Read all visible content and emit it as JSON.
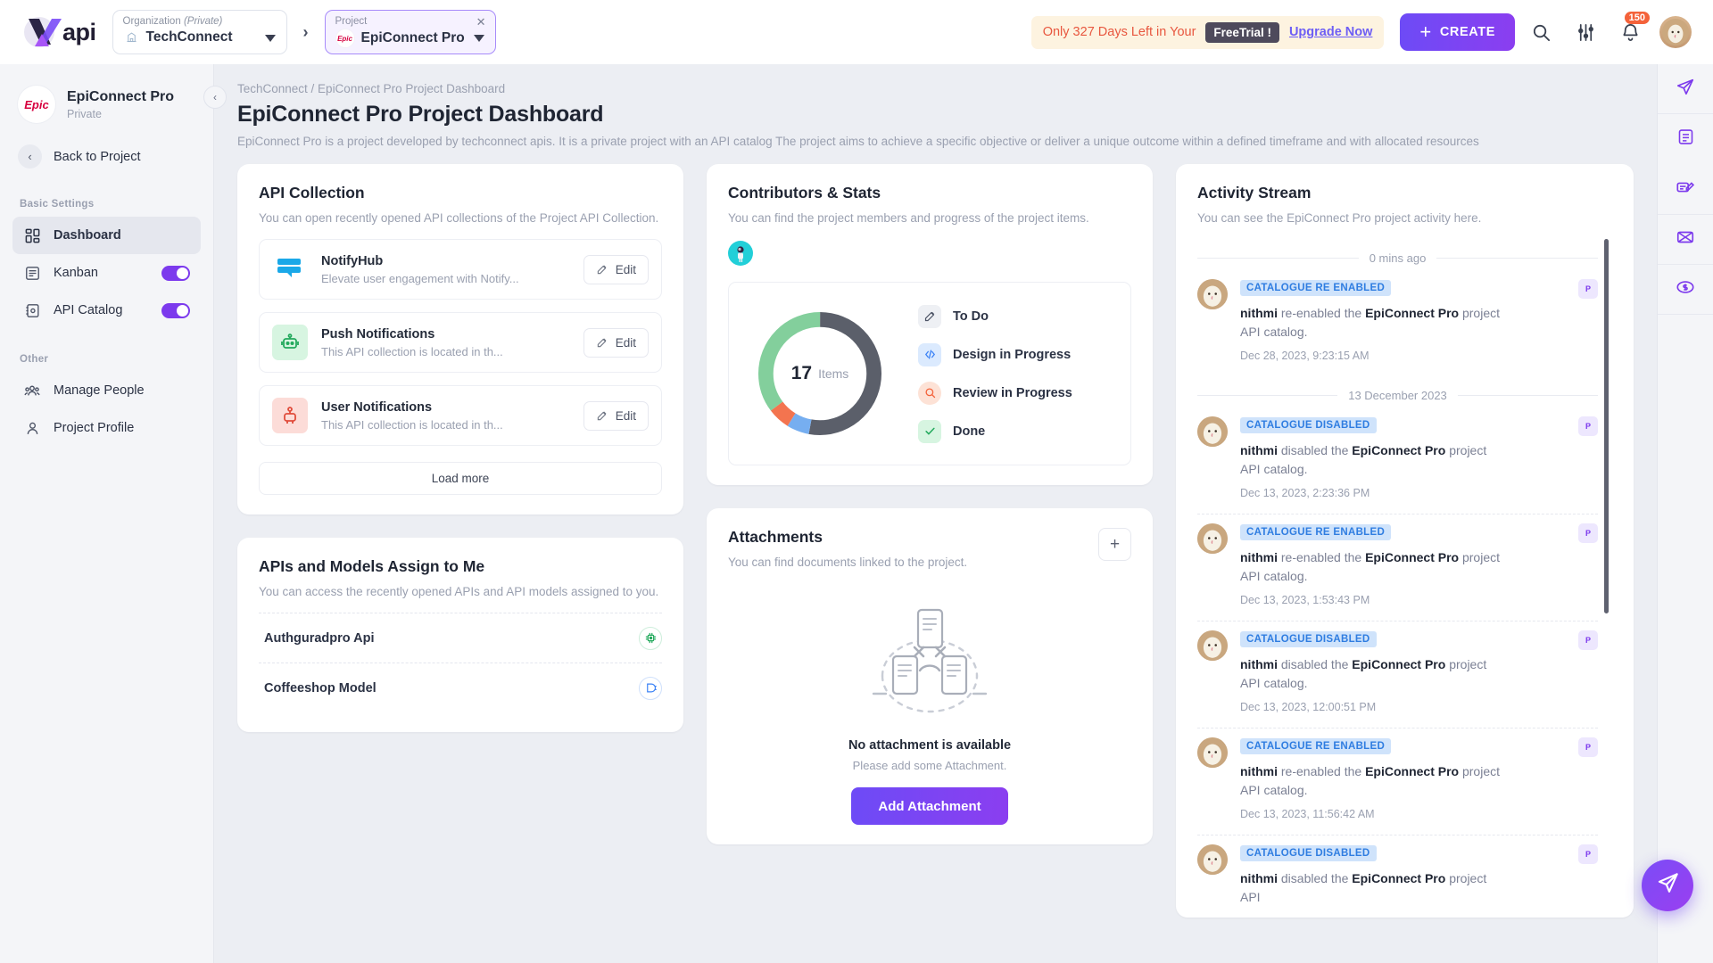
{
  "topbar": {
    "logo_text": "api",
    "organization": {
      "label": "Organization",
      "label_italic": "(Private)",
      "value": "TechConnect"
    },
    "project": {
      "label": "Project",
      "value": "EpiConnect Pro",
      "close_icon": "close-icon"
    },
    "trial": {
      "message": "Only 327 Days Left in Your",
      "pill": "FreeTrial !",
      "upgrade": "Upgrade Now"
    },
    "create_button": "CREATE",
    "notification_count": "150",
    "icons": [
      "search-icon",
      "filter-sliders-icon",
      "bell-icon",
      "user-avatar"
    ]
  },
  "sidebar": {
    "project_name": "EpiConnect Pro",
    "project_visibility": "Private",
    "project_badge": "Epic",
    "back_label": "Back to Project",
    "groups": [
      {
        "title": "Basic Settings",
        "items": [
          {
            "label": "Dashboard",
            "icon": "dashboard-grid-icon",
            "active": true,
            "toggle": false
          },
          {
            "label": "Kanban",
            "icon": "kanban-board-icon",
            "active": false,
            "toggle": true
          },
          {
            "label": "API Catalog",
            "icon": "api-catalog-icon",
            "active": false,
            "toggle": true
          }
        ]
      },
      {
        "title": "Other",
        "items": [
          {
            "label": "Manage People",
            "icon": "people-group-icon",
            "active": false,
            "toggle": false
          },
          {
            "label": "Project Profile",
            "icon": "person-icon",
            "active": false,
            "toggle": false
          }
        ]
      }
    ]
  },
  "page": {
    "breadcrumb": "TechConnect / EpiConnect Pro Project Dashboard",
    "title": "EpiConnect Pro Project Dashboard",
    "description": "EpiConnect Pro is a project developed by techconnect apis. It is a private project with an API catalog The project aims to achieve a specific objective or deliver a unique outcome within a defined timeframe and with allocated resources"
  },
  "api_collection": {
    "title": "API Collection",
    "subtitle": "You can open recently opened API collections of the Project API Collection.",
    "edit_label": "Edit",
    "load_more": "Load more",
    "items": [
      {
        "name": "NotifyHub",
        "desc": "Elevate user engagement with Notify...",
        "icon": "chat-stack-icon",
        "icon_bg": "#ffffff",
        "icon_color": "#1aa8e8"
      },
      {
        "name": "Push Notifications",
        "desc": "This API collection is located in th...",
        "icon": "robot-icon",
        "icon_bg": "#d7f5e1",
        "icon_color": "#22a95c"
      },
      {
        "name": "User Notifications",
        "desc": "This API collection is located in th...",
        "icon": "user-robot-icon",
        "icon_bg": "#fcdcd8",
        "icon_color": "#e04b3a"
      }
    ]
  },
  "assign": {
    "title": "APIs and Models Assign to Me",
    "subtitle": "You can access the recently opened APIs and API models assigned to you.",
    "items": [
      {
        "name": "Authguradpro Api",
        "icon": "chip-icon",
        "color": "#22a95c"
      },
      {
        "name": "Coffeeshop Model",
        "icon": "model-plug-icon",
        "color": "#3b82f6"
      }
    ]
  },
  "contributors": {
    "title": "Contributors & Stats",
    "subtitle": "You can find the project members and progress of the project items.",
    "avatar": "astronaut-avatar"
  },
  "chart_data": {
    "type": "pie",
    "title": "Project Items Progress",
    "center_value": "17",
    "center_label": "Items",
    "total": 17,
    "categories": [
      "To Do",
      "Design in Progress",
      "Review in Progress",
      "Done"
    ],
    "values": [
      9,
      1,
      1,
      6
    ],
    "colors": [
      "#5b5f6a",
      "#83cf9c",
      "#f3744f",
      "#76aef0"
    ],
    "legend": [
      {
        "label": "To Do",
        "icon": "edit-square-icon",
        "icon_bg": "#eef0f4",
        "icon_color": "#4c5365"
      },
      {
        "label": "Design in Progress",
        "icon": "code-brackets-icon",
        "icon_bg": "#dbeafe",
        "icon_color": "#3b82f6"
      },
      {
        "label": "Review in Progress",
        "icon": "magnifier-icon",
        "icon_bg": "#fde2d6",
        "icon_color": "#f4623a"
      },
      {
        "label": "Done",
        "icon": "check-icon",
        "icon_bg": "#d7f5e1",
        "icon_color": "#22a95c"
      }
    ],
    "legend_position": "right",
    "grid": false
  },
  "attachments": {
    "title": "Attachments",
    "subtitle": "You can find documents linked to the project.",
    "add_icon": "plus-icon",
    "empty_title": "No attachment is available",
    "empty_sub": "Please add some Attachment.",
    "button": "Add Attachment"
  },
  "activity": {
    "title": "Activity Stream",
    "subtitle": "You can see the EpiConnect Pro project activity here.",
    "groups": [
      {
        "separator": "0 mins ago",
        "entries": [
          {
            "tag": "CATALOGUE RE ENABLED",
            "actor": "nithmi",
            "action": "re-enabled the",
            "target": "EpiConnect Pro",
            "suffix": "project API catalog.",
            "time": "Dec 28, 2023, 9:23:15 AM",
            "right_icon": "project-catalog-icon"
          }
        ]
      },
      {
        "separator": "13 December 2023",
        "entries": [
          {
            "tag": "CATALOGUE DISABLED",
            "actor": "nithmi",
            "action": "disabled the",
            "target": "EpiConnect Pro",
            "suffix": "project API catalog.",
            "time": "Dec 13, 2023, 2:23:36 PM",
            "right_icon": "project-catalog-icon"
          },
          {
            "tag": "CATALOGUE RE ENABLED",
            "actor": "nithmi",
            "action": "re-enabled the",
            "target": "EpiConnect Pro",
            "suffix": "project API catalog.",
            "time": "Dec 13, 2023, 1:53:43 PM",
            "right_icon": "project-catalog-icon"
          },
          {
            "tag": "CATALOGUE DISABLED",
            "actor": "nithmi",
            "action": "disabled the",
            "target": "EpiConnect Pro",
            "suffix": "project API catalog.",
            "time": "Dec 13, 2023, 12:00:51 PM",
            "right_icon": "project-catalog-icon"
          },
          {
            "tag": "CATALOGUE RE ENABLED",
            "actor": "nithmi",
            "action": "re-enabled the",
            "target": "EpiConnect Pro",
            "suffix": "project API catalog.",
            "time": "Dec 13, 2023, 11:56:42 AM",
            "right_icon": "project-catalog-icon"
          },
          {
            "tag": "CATALOGUE DISABLED",
            "actor": "nithmi",
            "action": "disabled the",
            "target": "EpiConnect Pro",
            "suffix": "project API",
            "time": "",
            "right_icon": "project-catalog-icon"
          }
        ]
      }
    ]
  },
  "rail": {
    "items": [
      {
        "icon": "paper-plane-icon"
      },
      {
        "icon": "document-icon"
      },
      {
        "icon": "sign-edit-icon"
      },
      {
        "icon": "network-icon"
      },
      {
        "icon": "dollar-icon"
      }
    ],
    "fab_icon": "plane-fab-icon"
  }
}
